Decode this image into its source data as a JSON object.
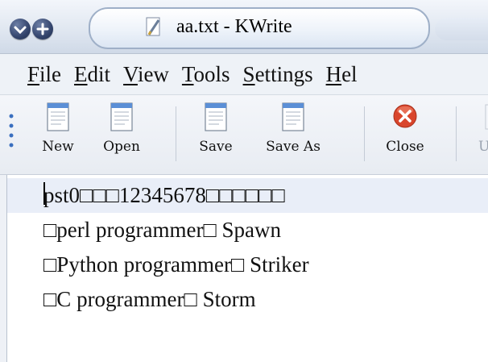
{
  "window": {
    "title": "aa.txt - KWrite"
  },
  "menu": {
    "items": [
      {
        "first": "F",
        "rest": "ile"
      },
      {
        "first": "E",
        "rest": "dit"
      },
      {
        "first": "V",
        "rest": "iew"
      },
      {
        "first": "T",
        "rest": "ools"
      },
      {
        "first": "S",
        "rest": "ettings"
      },
      {
        "first": "H",
        "rest": "el"
      }
    ]
  },
  "toolbar": {
    "new": "New",
    "open": "Open",
    "save": "Save",
    "save_as": "Save As",
    "close": "Close",
    "undo_partial": "U"
  },
  "editor": {
    "lines": [
      "pst0□□□12345678□□□□□□",
      "□perl programmer□   Spawn",
      "□Python programmer□   Striker",
      "□C programmer□   Storm"
    ]
  },
  "colors": {
    "current_line_bg": "#e9eef8",
    "close_icon": "#d9452c",
    "title_tab_border": "#9fb0c8"
  }
}
